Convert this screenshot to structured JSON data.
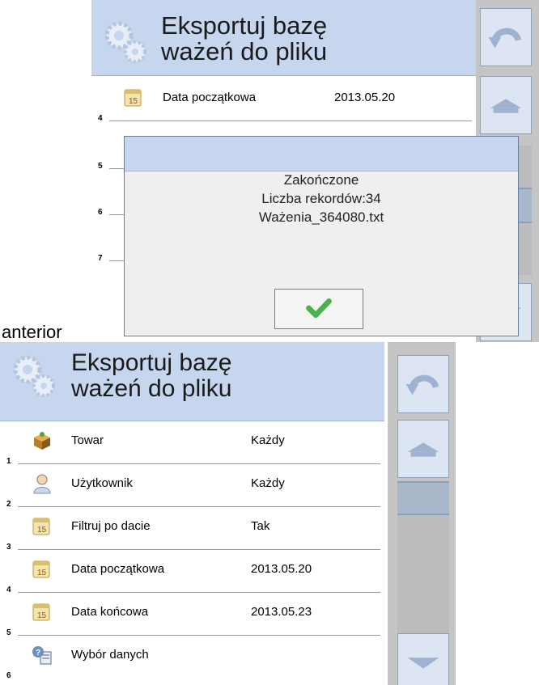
{
  "colors": {
    "header": "#c6d6ee",
    "sidebar": "#c5c5c5",
    "dialog": "#efefef",
    "check": "#4caf50"
  },
  "top_screen": {
    "title_line1": "Eksportuj bazę",
    "title_line2": "ważeń do pliku",
    "visible_row": {
      "label": "Data początkowa",
      "value": "2013.05.20",
      "number": "4"
    },
    "row_numbers": [
      "5",
      "6",
      "7"
    ],
    "dialog": {
      "line1": "Zakończone",
      "line2": "Liczba rekordów:34",
      "line3": "Ważenia_364080.txt",
      "ok_icon": "check-icon"
    }
  },
  "caption": "anterior",
  "bottom_screen": {
    "title_line1": "Eksportuj bazę",
    "title_line2": "ważeń do pliku",
    "rows": [
      {
        "number": "1",
        "label": "Towar",
        "value": "Każdy",
        "icon": "product-box-icon"
      },
      {
        "number": "2",
        "label": "Użytkownik",
        "value": "Każdy",
        "icon": "user-icon"
      },
      {
        "number": "3",
        "label": "Filtruj po dacie",
        "value": "Tak",
        "icon": "calendar-icon"
      },
      {
        "number": "4",
        "label": "Data początkowa",
        "value": "2013.05.20",
        "icon": "calendar-icon"
      },
      {
        "number": "5",
        "label": "Data końcowa",
        "value": "2013.05.23",
        "icon": "calendar-icon"
      },
      {
        "number": "6",
        "label": "Wybór danych",
        "value": "",
        "icon": "data-selection-icon"
      }
    ]
  }
}
